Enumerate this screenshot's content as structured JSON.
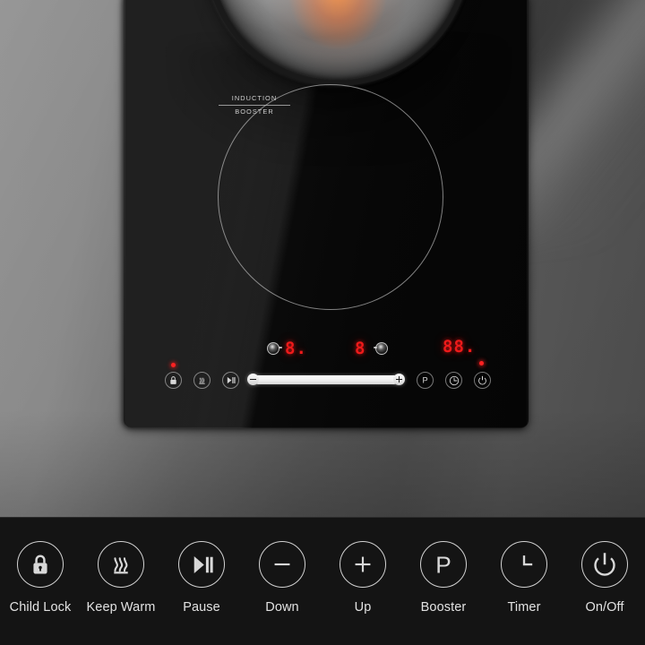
{
  "scene": {
    "background_color": "#6d6d6d",
    "product": "induction cooktop",
    "cooktop_surface_color": "#0a0a0a"
  },
  "cooktop": {
    "zone": {
      "label_line1": "INDUCTION",
      "label_line2": "BOOSTER",
      "name": "induction-booster-zone"
    },
    "pot": {
      "name": "cooking-pot"
    },
    "display": {
      "left_power_value": "8.",
      "right_power_value": "8",
      "timer_value": "88.",
      "accent_color": "#ee1a1a"
    },
    "indicators": {
      "child_lock_led": "on",
      "power_led": "on",
      "led_color": "#ff2222"
    },
    "buttons": [
      {
        "key": "child-lock",
        "glyph": "lock"
      },
      {
        "key": "keep-warm",
        "glyph": "keep-warm"
      },
      {
        "key": "pause",
        "glyph": "play-pause"
      },
      {
        "key": "booster",
        "glyph": "P"
      },
      {
        "key": "timer",
        "glyph": "clock"
      },
      {
        "key": "on-off",
        "glyph": "power"
      }
    ],
    "slider": {
      "name": "power-level-slider",
      "minus_label": "−",
      "plus_label": "+",
      "fill_percent": 100
    }
  },
  "legend": {
    "items": [
      {
        "label": "Child Lock",
        "icon": "lock-icon"
      },
      {
        "label": "Keep Warm",
        "icon": "heat-waves-icon"
      },
      {
        "label": "Pause",
        "icon": "play-pause-icon"
      },
      {
        "label": "Down",
        "icon": "minus-circle-icon"
      },
      {
        "label": "Up",
        "icon": "plus-circle-icon"
      },
      {
        "label": "Booster",
        "icon": "letter-p-icon"
      },
      {
        "label": "Timer",
        "icon": "clock-icon"
      },
      {
        "label": "On/Off",
        "icon": "power-icon"
      }
    ]
  }
}
